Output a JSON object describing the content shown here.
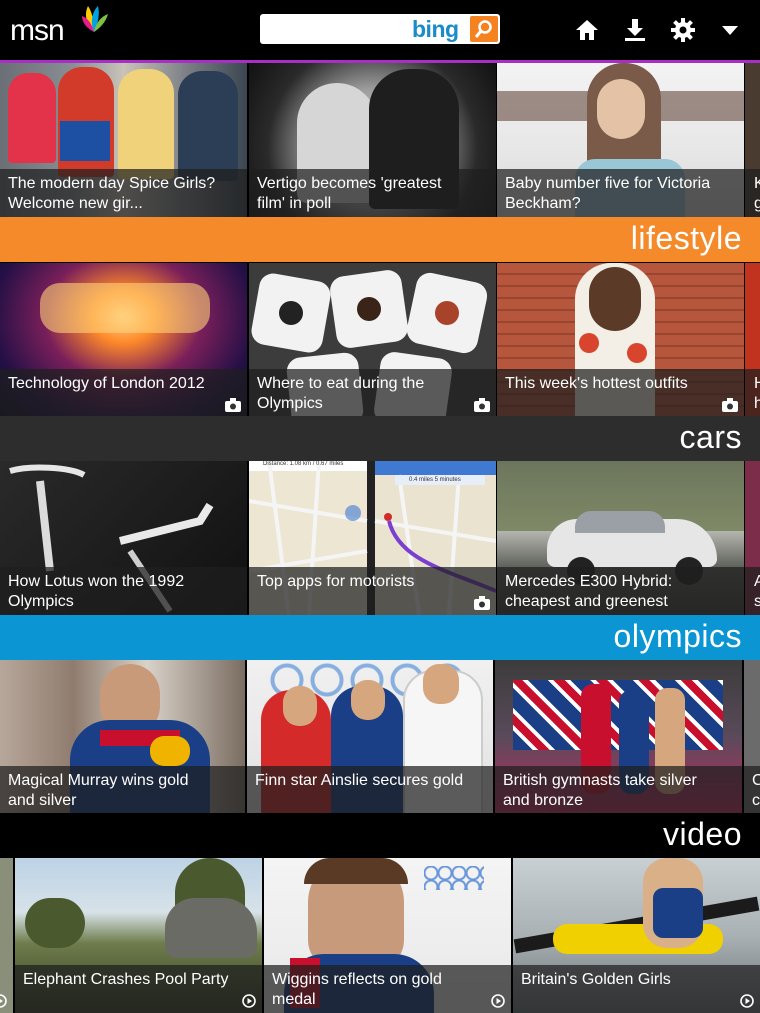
{
  "app": {
    "logo_text": "msn",
    "search_placeholder": "",
    "search_brand": "bing"
  },
  "top_nav": {
    "icons": [
      "home-icon",
      "download-icon",
      "settings-icon",
      "dropdown-arrow-icon"
    ]
  },
  "colors": {
    "accent_purple": "#a72fc4",
    "lifestyle": "#f58a2a",
    "cars": "#2d2d2d",
    "olympics": "#0b96d3",
    "video": "#000000",
    "bing_orange": "#f58220",
    "bing_blue": "#1b8bc9"
  },
  "sections": [
    {
      "title": "",
      "tiles": [
        {
          "caption": "The modern day Spice Girls? Welcome new gir...",
          "media": ""
        },
        {
          "caption": "Vertigo becomes 'greatest film' in poll",
          "media": ""
        },
        {
          "caption": "Baby number five for Victoria Beckham?",
          "media": ""
        },
        {
          "caption": "K g",
          "media": ""
        }
      ]
    },
    {
      "title": "lifestyle",
      "tiles": [
        {
          "caption": "Technology of London 2012",
          "media": "camera-icon"
        },
        {
          "caption": "Where to eat during the Olympics",
          "media": "camera-icon"
        },
        {
          "caption": "This week's hottest outfits",
          "media": "camera-icon"
        },
        {
          "caption": "H h",
          "media": ""
        }
      ]
    },
    {
      "title": "cars",
      "tiles": [
        {
          "caption": "How Lotus won the 1992 Olympics",
          "media": ""
        },
        {
          "caption": "Top apps for motorists",
          "media": "camera-icon"
        },
        {
          "caption": "Mercedes E300 Hybrid: cheapest and greenest",
          "media": ""
        },
        {
          "caption": "A s",
          "media": ""
        }
      ]
    },
    {
      "title": "olympics",
      "tiles": [
        {
          "caption": "Magical Murray wins gold and silver",
          "media": ""
        },
        {
          "caption": "Finn star Ainslie secures gold",
          "media": ""
        },
        {
          "caption": "British gymnasts take silver and bronze",
          "media": ""
        },
        {
          "caption": "C c",
          "media": ""
        }
      ]
    },
    {
      "title": "video",
      "tiles": [
        {
          "caption": "Elephant Crashes Pool Party",
          "media": "play-icon"
        },
        {
          "caption": "Wiggins reflects on gold medal",
          "media": "play-icon"
        },
        {
          "caption": "Britain's Golden Girls",
          "media": "play-icon"
        }
      ]
    }
  ],
  "map_overlay": {
    "distance": "Distance: 1.08 km / 0.67 miles",
    "eta": "0.4 miles  5 minutes"
  }
}
